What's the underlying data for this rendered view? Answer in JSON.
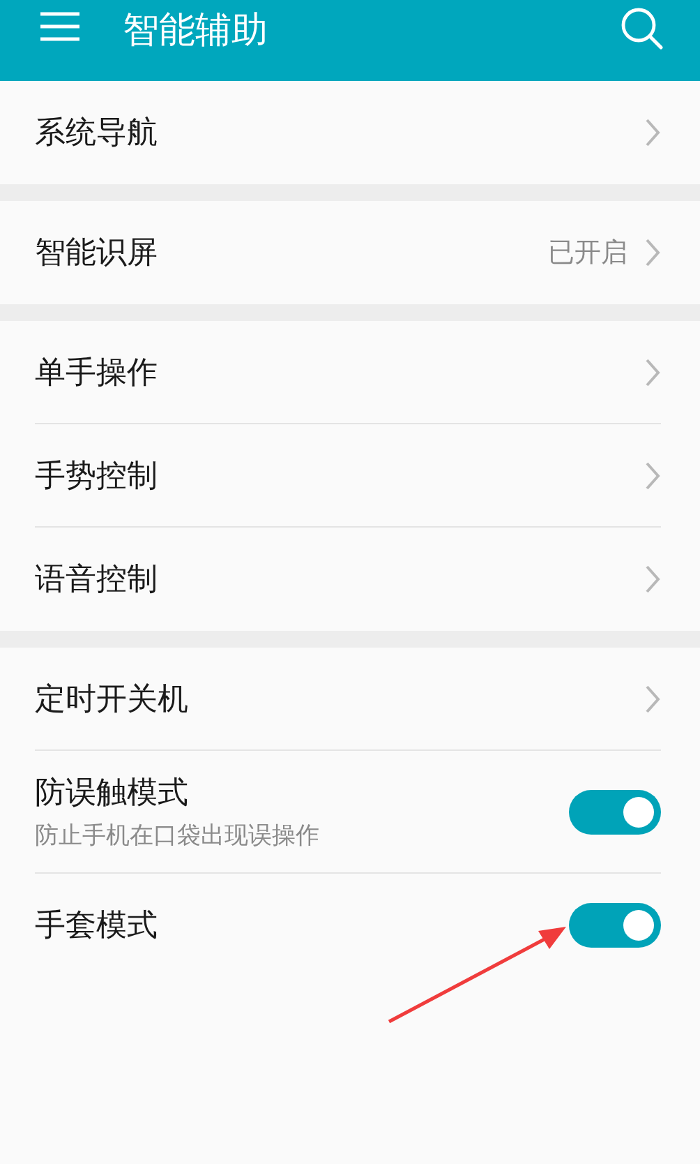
{
  "header": {
    "title": "智能辅助"
  },
  "sections": [
    {
      "items": [
        {
          "kind": "link",
          "label": "系统导航"
        }
      ]
    },
    {
      "items": [
        {
          "kind": "link",
          "label": "智能识屏",
          "value": "已开启"
        }
      ]
    },
    {
      "items": [
        {
          "kind": "link",
          "label": "单手操作"
        },
        {
          "kind": "link",
          "label": "手势控制"
        },
        {
          "kind": "link",
          "label": "语音控制"
        }
      ]
    },
    {
      "items": [
        {
          "kind": "link",
          "label": "定时开关机"
        },
        {
          "kind": "toggle",
          "label": "防误触模式",
          "subtitle": "防止手机在口袋出现误操作",
          "on": true
        },
        {
          "kind": "toggle",
          "label": "手套模式",
          "on": true
        }
      ]
    }
  ]
}
